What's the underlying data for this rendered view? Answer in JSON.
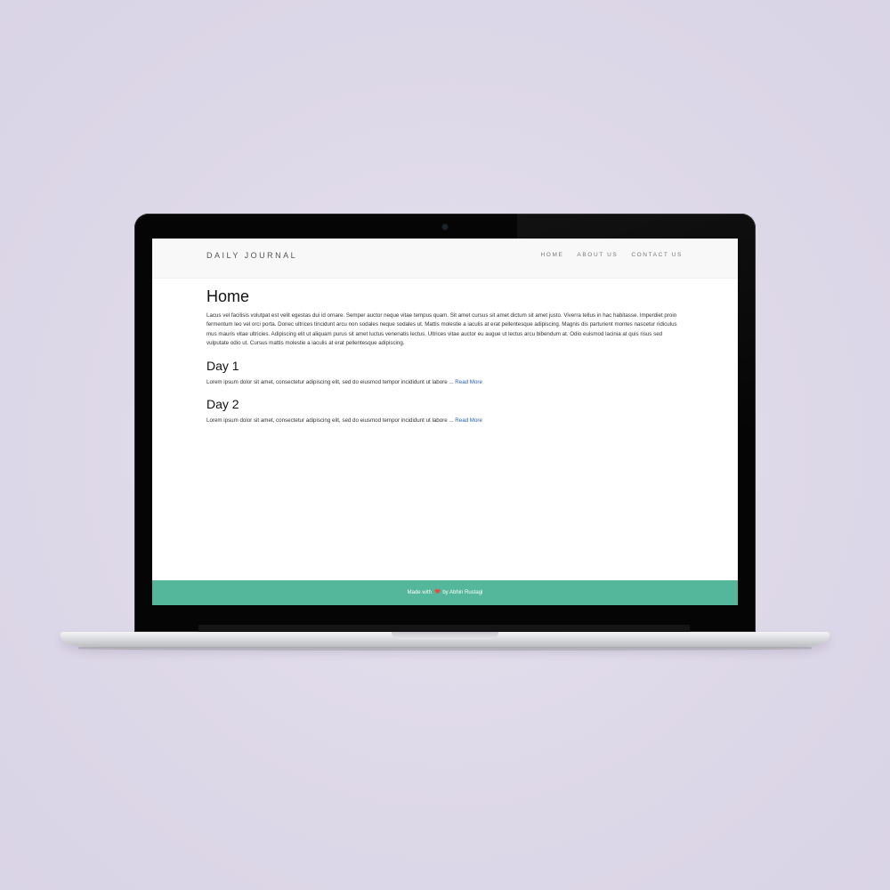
{
  "navbar": {
    "brand": "DAILY JOURNAL",
    "links": [
      "HOME",
      "ABOUT US",
      "CONTACT US"
    ]
  },
  "home": {
    "title": "Home",
    "content": "Lacus vel facilisis volutpat est velit egestas dui id ornare. Semper auctor neque vitae tempus quam. Sit amet cursus sit amet dictum sit amet justo. Viverra tellus in hac habitasse. Imperdiet proin fermentum leo vel orci porta. Donec ultrices tincidunt arcu non sodales neque sodales ut. Mattis molestie a iaculis at erat pellentesque adipiscing. Magnis dis parturient montes nascetur ridiculus mus mauris vitae ultricies. Adipiscing elit ut aliquam purus sit amet luctus venenatis lectus. Ultrices vitae auctor eu augue ut lectus arcu bibendum at. Odio euismod lacinia at quis risus sed vulputate odio ut. Cursus mattis molestie a iaculis at erat pellentesque adipiscing."
  },
  "posts": [
    {
      "title": "Day 1",
      "excerpt": "Lorem ipsum dolor sit amet, consectetur adipiscing elit, sed do eiusmod tempor incididunt ut labore ...",
      "read_more": "Read More"
    },
    {
      "title": "Day 2",
      "excerpt": "Lorem ipsum dolor sit amet, consectetur adipiscing elit, sed do eiusmod tempor incididunt ut labore ...",
      "read_more": "Read More"
    }
  ],
  "footer": {
    "prefix": "Made with",
    "icon": "heart-icon",
    "suffix": "by Abhin Rustagi"
  },
  "colors": {
    "footer_bg": "#54b69a",
    "link": "#2561b4",
    "navbar_bg": "#f8f8f8",
    "page_bg": "#ddd8e8",
    "heart": "#e74c3c"
  }
}
